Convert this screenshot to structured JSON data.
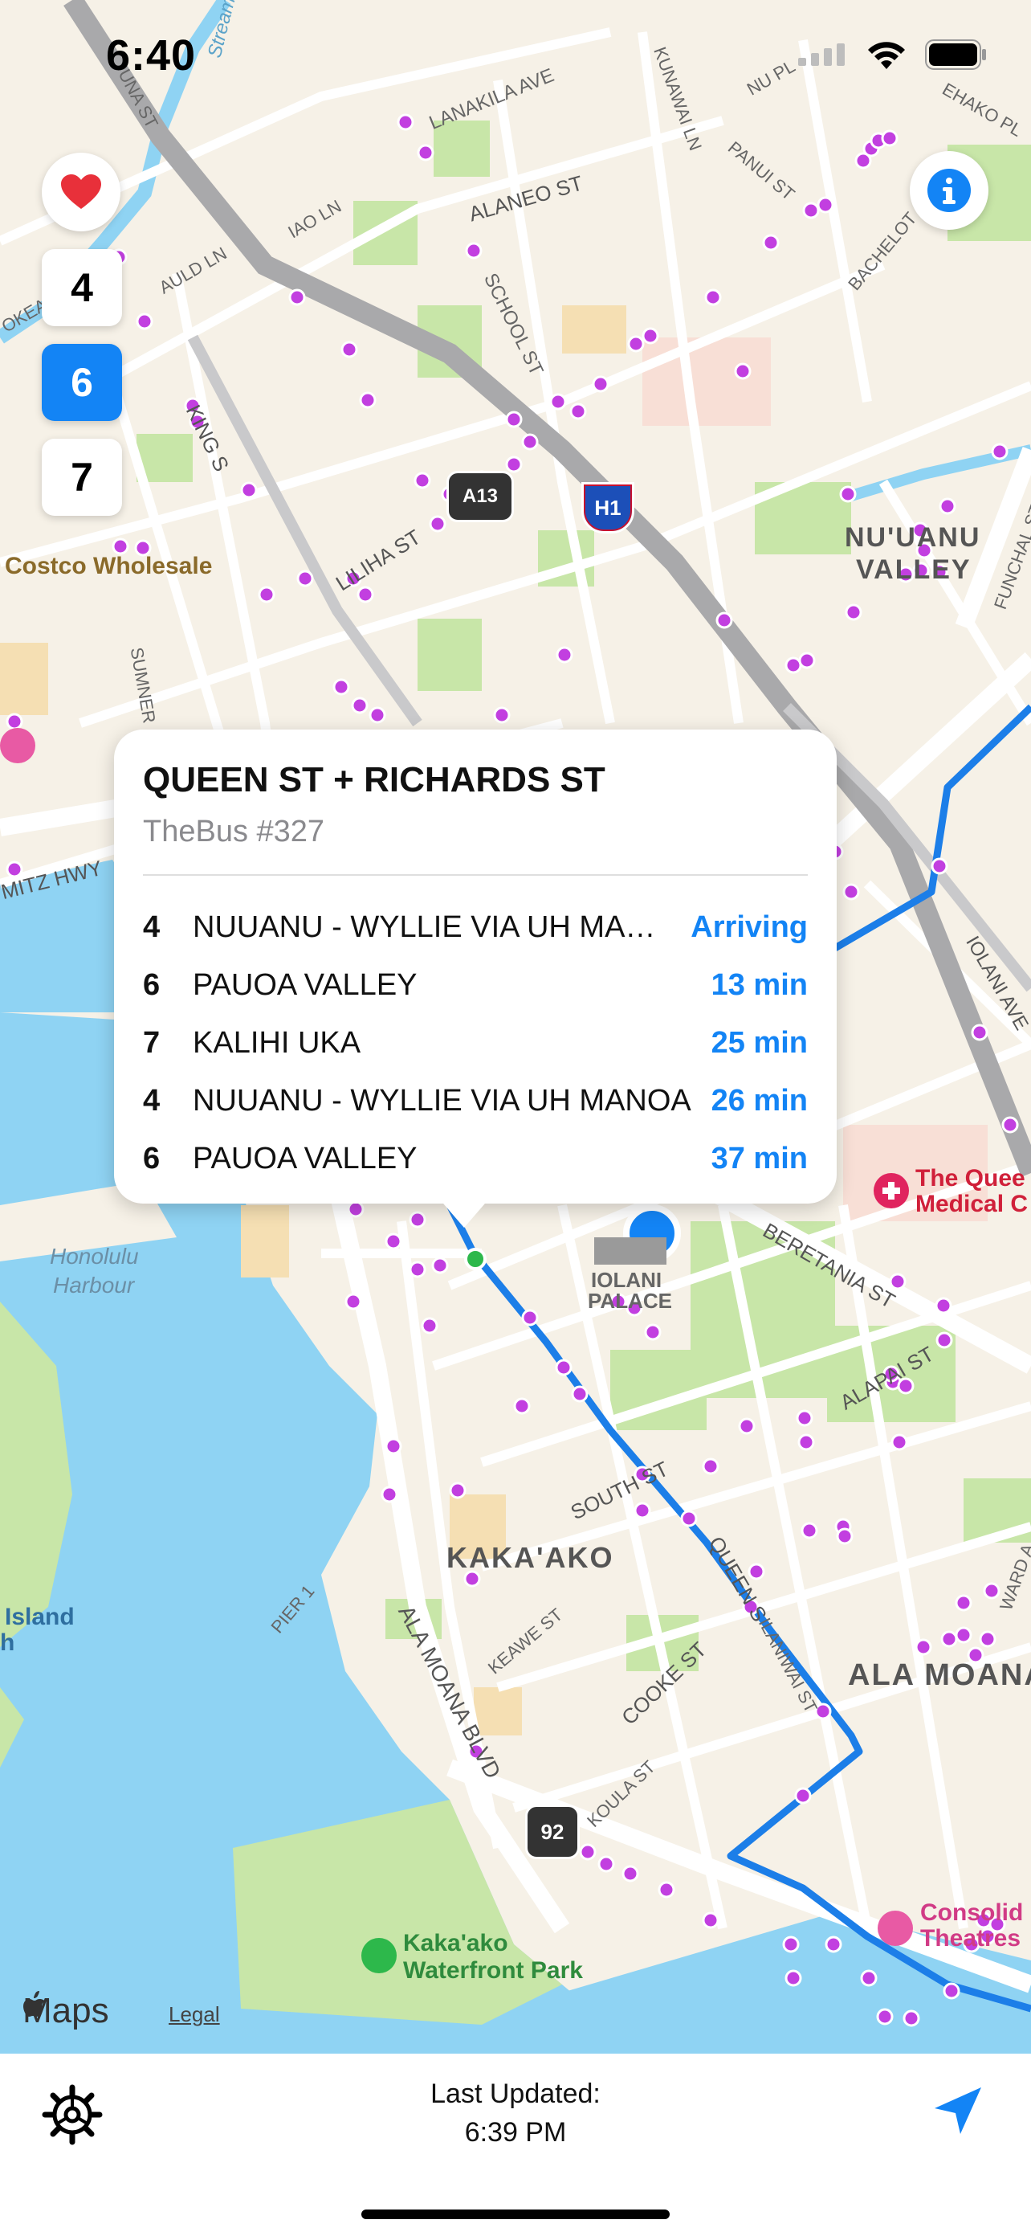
{
  "status_bar": {
    "time": "6:40"
  },
  "route_buttons": [
    {
      "label": "4",
      "active": false
    },
    {
      "label": "6",
      "active": true
    },
    {
      "label": "7",
      "active": false
    }
  ],
  "map_labels": {
    "costco": "Costco Wholesale",
    "nuuanu": "NU'UANU",
    "valley": "VALLEY",
    "honolulu": "Honolulu",
    "harbour": "Harbour",
    "iolani": "IOLANI",
    "palace": "PALACE",
    "kakaako": "KAKA'AKO",
    "ala_moana": "ALA MOANA",
    "waterfront1": "Kaka'ako",
    "waterfront2": "Waterfront Park",
    "queens1": "The Quee",
    "queens2": "Medical C",
    "consolid1": "Consolid",
    "consolid2": "Theatres",
    "island": "Island",
    "island2": "h",
    "shield_h1": "H1",
    "shield_92": "92",
    "shield_a13": "A13",
    "streets": {
      "lanakila": "LANAKILA AVE",
      "alaneo": "ALANEO ST",
      "school": "SCHOOL ST",
      "kunawai": "KUNAWAI LN",
      "panui": "PANUI ST",
      "nupl": "NU PL",
      "ehako": "EHAKO PL",
      "bachelot": "BACHELOT",
      "iao": "IAO LN",
      "auld": "AULD LN",
      "king": "KING S",
      "liliha": "LILIHA ST",
      "sumner": "SUMNER",
      "nimitz": "MITZ HWY",
      "funchal": "FUNCHAL ST",
      "iolaniave": "IOLANI AVE",
      "beretania": "BERETANIA ST",
      "alapai": "ALAPAI ST",
      "south": "SOUTH ST",
      "queen": "QUEEN S",
      "ilaniwai": "ILANIWAI ST",
      "cooke": "COOKE ST",
      "keawe": "KEAWE ST",
      "ala_moana_blvd": "ALA MOANA BLVD",
      "koula": "KOULA ST",
      "pier": "PIER 1",
      "ward": "WARD A",
      "stream": "Stream",
      "una": "UNA ST",
      "okea": "OKEA"
    }
  },
  "stop": {
    "name": "QUEEN ST + RICHARDS ST",
    "subtitle": "TheBus #327",
    "arrivals": [
      {
        "route": "4",
        "destination": "NUUANU - WYLLIE VIA UH MANOA",
        "time": "Arriving"
      },
      {
        "route": "6",
        "destination": "PAUOA VALLEY",
        "time": "13 min"
      },
      {
        "route": "7",
        "destination": "KALIHI UKA",
        "time": "25 min"
      },
      {
        "route": "4",
        "destination": "NUUANU - WYLLIE VIA UH MANOA",
        "time": "26 min"
      },
      {
        "route": "6",
        "destination": "PAUOA VALLEY",
        "time": "37 min"
      }
    ]
  },
  "attribution": {
    "maps": "Maps",
    "legal": "Legal"
  },
  "footer": {
    "last_updated_label": "Last Updated:",
    "last_updated_time": "6:39 PM"
  },
  "colors": {
    "accent": "#1384f5",
    "stop_dot": "#c23fe0",
    "water": "#8fd3f3",
    "park": "#c8e6a8",
    "road": "#ffffff",
    "highway": "#a9a9ab"
  }
}
